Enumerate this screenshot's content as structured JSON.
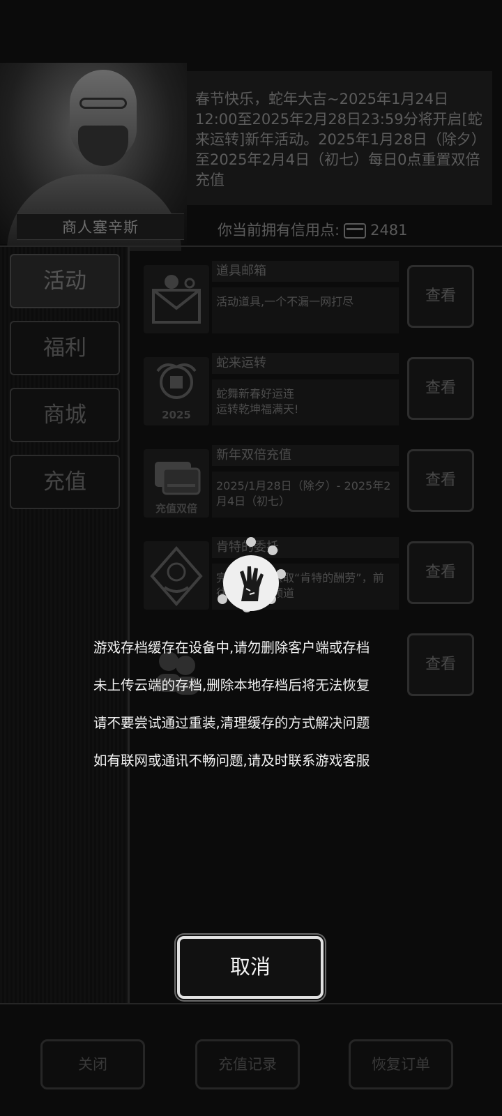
{
  "merchant": {
    "name": "商人塞辛斯"
  },
  "notice": {
    "text": "春节快乐，蛇年大吉~2025年1月24日12:00至2025年2月28日23:59分将开启[蛇来运转]新年活动。2025年1月28日（除夕）至2025年2月4日（初七）每日0点重置双倍充值"
  },
  "credits": {
    "label": "你当前拥有信用点:",
    "value": "2481",
    "icon": "credit-card-icon"
  },
  "sidebar": {
    "tabs": [
      {
        "label": "活动"
      },
      {
        "label": "福利"
      },
      {
        "label": "商城"
      },
      {
        "label": "充值"
      }
    ]
  },
  "events": [
    {
      "title": "道具邮箱",
      "desc": "活动道具,一个不漏一网打尽",
      "button": "查看",
      "icon": "mail-icon"
    },
    {
      "title": "蛇来运转",
      "desc": "蛇舞新春好运连\n运转乾坤福满天!",
      "button": "查看",
      "icon": "snake-2025-icon",
      "icon_text": "2025"
    },
    {
      "title": "新年双倍充值",
      "desc": "2025/1月28日（除夕）- 2025年2月4日（初七）",
      "button": "查看",
      "icon": "double-recharge-icon",
      "icon_text": "充值双倍"
    },
    {
      "title": "肯特的委托",
      "desc": "完成任务，赚取“肯特的酬劳”，前往电台活动频道",
      "button": "查看",
      "icon": "k-emblem-icon"
    },
    {
      "title": "",
      "desc": "",
      "button": "查看",
      "icon": "people-icon"
    }
  ],
  "footer": {
    "close": "关闭",
    "recharge_history": "充值记录",
    "restore_order": "恢复订单"
  },
  "overlay": {
    "lines": [
      "游戏存档缓存在设备中,请勿删除客户端或存档",
      "未上传云端的存档,删除本地存档后将无法恢复",
      "请不要尝试通过重装,清理缓存的方式解决问题",
      "如有联网或通讯不畅问题,请及时联系游戏客服"
    ],
    "cancel": "取消",
    "spinner_icon": "zombie-hand-icon"
  }
}
